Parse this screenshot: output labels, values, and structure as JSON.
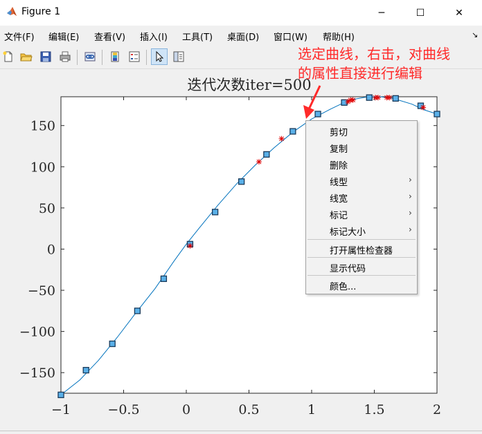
{
  "window": {
    "title": "Figure 1",
    "controls": {
      "minimize": "─",
      "maximize": "☐",
      "close": "✕"
    }
  },
  "menu": [
    {
      "id": "file",
      "label": "文件(F)"
    },
    {
      "id": "edit",
      "label": "编辑(E)"
    },
    {
      "id": "view",
      "label": "查看(V)"
    },
    {
      "id": "insert",
      "label": "插入(I)"
    },
    {
      "id": "tools",
      "label": "工具(T)"
    },
    {
      "id": "desktop",
      "label": "桌面(D)"
    },
    {
      "id": "window",
      "label": "窗口(W)"
    },
    {
      "id": "help",
      "label": "帮助(H)"
    }
  ],
  "dock_icon": "↘",
  "toolbar": {
    "buttons": [
      "new-figure-icon",
      "open-file-icon",
      "save-icon",
      "print-icon",
      "link-plot-icon",
      "insert-colorbar-icon",
      "insert-legend-icon",
      "edit-plot-arrow-icon",
      "property-inspector-icon"
    ],
    "active": "edit-plot-arrow-icon"
  },
  "chart_data": {
    "type": "line",
    "title": "迭代次数iter=500",
    "xlim": [
      -1,
      2
    ],
    "ylim": [
      -180,
      185
    ],
    "xticks": [
      -1,
      -0.5,
      0,
      0.5,
      1,
      1.5,
      2
    ],
    "xtick_labels": [
      "−1",
      "−0.5",
      "0",
      "0.5",
      "1",
      "1.5",
      "2"
    ],
    "yticks": [
      -150,
      -100,
      -50,
      0,
      50,
      100,
      150
    ],
    "ytick_labels": [
      "−150",
      "−100",
      "−50",
      "0",
      "50",
      "100",
      "150"
    ],
    "grid": false,
    "series": [
      {
        "kind": "curve",
        "color": "#0072bd",
        "x": [
          -1,
          -0.85,
          -0.7,
          -0.55,
          -0.4,
          -0.25,
          -0.1,
          0,
          0.1,
          0.25,
          0.4,
          0.55,
          0.7,
          0.85,
          1.0,
          1.15,
          1.3,
          1.45,
          1.55,
          1.65,
          1.8,
          1.9,
          2.0
        ],
        "y": [
          -177,
          -159,
          -135,
          -107,
          -77,
          -48,
          -15,
          6,
          25,
          53,
          79,
          102,
          123,
          142,
          158,
          170,
          181,
          185,
          185,
          183,
          176,
          169,
          164
        ]
      },
      {
        "kind": "markers",
        "marker": "square",
        "color": "#0072bd",
        "fill": "#5ab0e8",
        "x": [
          -1,
          -0.8,
          -0.59,
          -0.39,
          -0.18,
          0.03,
          0.23,
          0.44,
          0.64,
          0.85,
          1.05,
          1.26,
          1.46,
          1.67,
          1.87,
          2.0
        ],
        "y": [
          -177,
          -147,
          -115,
          -75,
          -36,
          6,
          45,
          82,
          115,
          143,
          164,
          178,
          184,
          183,
          174,
          164
        ]
      },
      {
        "kind": "markers",
        "marker": "asterisk",
        "color": "#e00000",
        "x": [
          0.03,
          0.58,
          0.76,
          1.29,
          1.31,
          1.33,
          1.51,
          1.53,
          1.6,
          1.62,
          1.89
        ],
        "y": [
          4,
          106,
          134,
          179,
          181,
          181,
          184,
          184,
          184,
          184,
          172
        ]
      }
    ]
  },
  "context_menu": {
    "items": [
      {
        "id": "cut",
        "label": "剪切",
        "submenu": false
      },
      {
        "id": "copy",
        "label": "复制",
        "submenu": false
      },
      {
        "id": "delete",
        "label": "删除",
        "submenu": false
      },
      {
        "id": "line-style",
        "label": "线型",
        "submenu": true
      },
      {
        "id": "line-width",
        "label": "线宽",
        "submenu": true
      },
      {
        "id": "marker",
        "label": "标记",
        "submenu": true
      },
      {
        "id": "marker-size",
        "label": "标记大小",
        "submenu": true
      },
      {
        "id": "open-inspector",
        "label": "打开属性检查器",
        "submenu": false
      },
      {
        "id": "show-code",
        "label": "显示代码",
        "submenu": false
      },
      {
        "id": "color",
        "label": "颜色...",
        "submenu": false
      }
    ],
    "submenu_arrow": "›"
  },
  "annotation": {
    "lines": [
      "选定曲线，右击，对曲线",
      "的属性直接进行编辑"
    ],
    "color": "#ff2a2a"
  }
}
